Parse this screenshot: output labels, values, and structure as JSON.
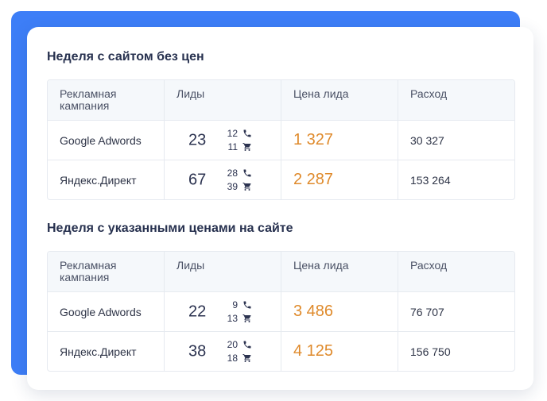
{
  "colors": {
    "accent_blue": "#3d7ef7",
    "price_orange": "#df8a2b",
    "text_dark": "#27314f",
    "border": "#e6eaf0",
    "header_bg": "#f5f8fb"
  },
  "icons": {
    "phone": "phone-icon",
    "cart": "cart-icon"
  },
  "sections": [
    {
      "title": "Неделя с сайтом без цен",
      "headers": {
        "campaign": "Рекламная кампания",
        "leads": "Лиды",
        "lead_price": "Цена лида",
        "spend": "Расход"
      },
      "rows": [
        {
          "campaign": "Google Adwords",
          "leads": "23",
          "calls": "12",
          "orders": "11",
          "lead_price": "1 327",
          "spend": "30 327"
        },
        {
          "campaign": "Яндекс.Директ",
          "leads": "67",
          "calls": "28",
          "orders": "39",
          "lead_price": "2 287",
          "spend": "153 264"
        }
      ]
    },
    {
      "title": "Неделя с указанными ценами на сайте",
      "headers": {
        "campaign": "Рекламная кампания",
        "leads": "Лиды",
        "lead_price": "Цена лида",
        "spend": "Расход"
      },
      "rows": [
        {
          "campaign": "Google Adwords",
          "leads": "22",
          "calls": "9",
          "orders": "13",
          "lead_price": "3 486",
          "spend": "76 707"
        },
        {
          "campaign": "Яндекс.Директ",
          "leads": "38",
          "calls": "20",
          "orders": "18",
          "lead_price": "4 125",
          "spend": "156 750"
        }
      ]
    }
  ]
}
